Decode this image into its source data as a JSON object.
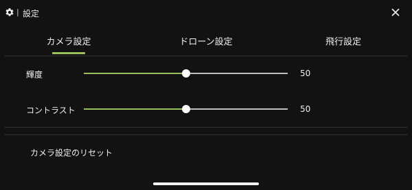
{
  "header": {
    "title": "設定",
    "separator": "|",
    "icon": "gear-icon",
    "close_icon": "close-icon"
  },
  "tabs": [
    {
      "label": "カメラ設定",
      "active": true
    },
    {
      "label": "ドローン設定",
      "active": false
    },
    {
      "label": "飛行設定",
      "active": false
    }
  ],
  "settings": {
    "brightness": {
      "label": "輝度",
      "value": "50",
      "fraction": 0.5
    },
    "contrast": {
      "label": "コントラスト",
      "value": "50",
      "fraction": 0.5
    }
  },
  "reset_label": "カメラ設定のリセット",
  "colors": {
    "accent": "#9ac15b",
    "background": "#121212",
    "track": "#bfbfbf"
  }
}
